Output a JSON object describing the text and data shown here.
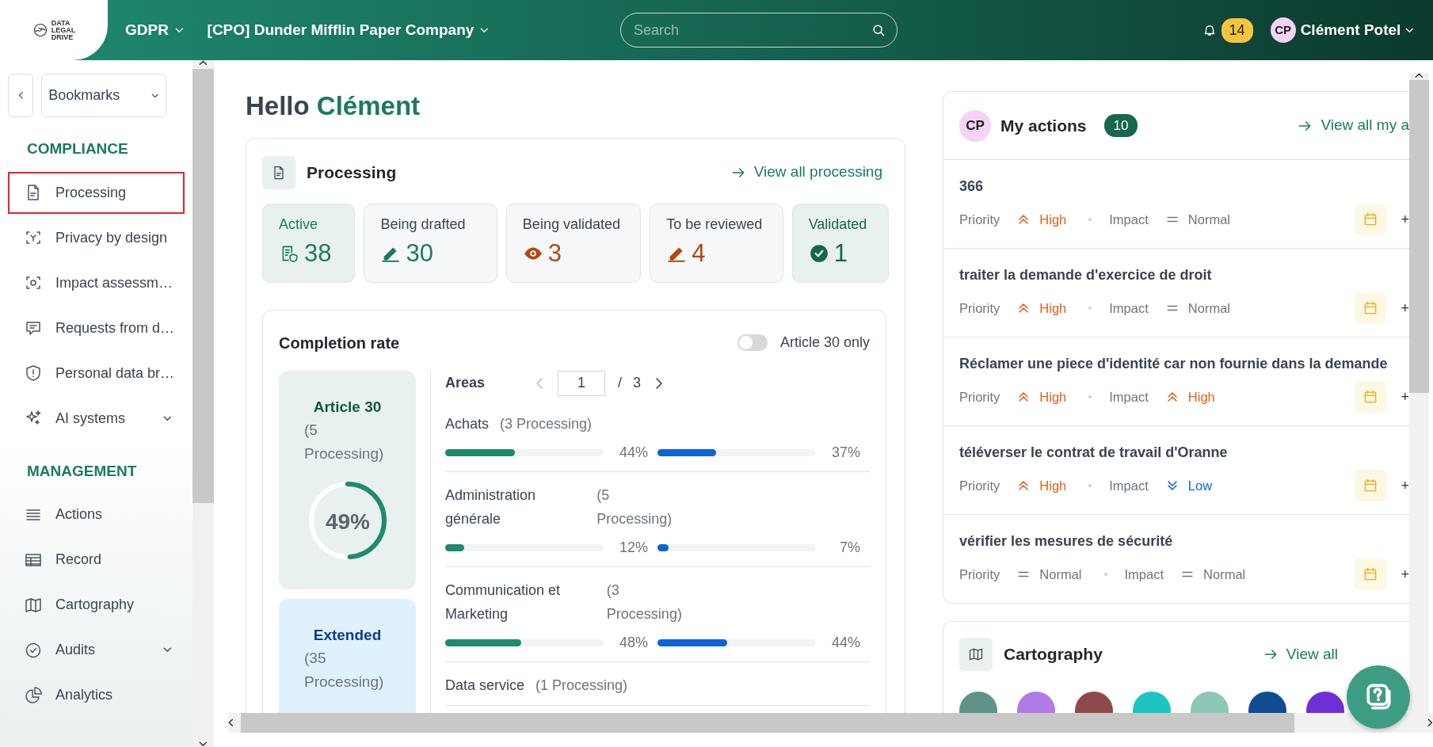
{
  "header": {
    "logo_lines": [
      "DATA",
      "LEGAL",
      "DRIVE"
    ],
    "app_menu": "GDPR",
    "org_menu": "[CPO] Dunder Mifflin Paper Company",
    "search": {
      "placeholder": "Search"
    },
    "notifications": "14",
    "user": {
      "initials": "CP",
      "name": "Clément Potel"
    }
  },
  "sidebar": {
    "bookmarks": "Bookmarks",
    "sections": [
      {
        "title": "COMPLIANCE",
        "items": [
          {
            "label": "Processing",
            "kind": "document",
            "selected": true,
            "expandable": false
          },
          {
            "label": "Privacy by design",
            "kind": "privacy",
            "selected": false,
            "expandable": false
          },
          {
            "label": "Impact assessm…",
            "kind": "impact",
            "selected": false,
            "expandable": false
          },
          {
            "label": "Requests from d…",
            "kind": "request",
            "selected": false,
            "expandable": false
          },
          {
            "label": "Personal data br…",
            "kind": "shield",
            "selected": false,
            "expandable": false
          },
          {
            "label": "AI systems",
            "kind": "sparkles",
            "selected": false,
            "expandable": true
          }
        ]
      },
      {
        "title": "MANAGEMENT",
        "items": [
          {
            "label": "Actions",
            "kind": "list",
            "selected": false,
            "expandable": false
          },
          {
            "label": "Record",
            "kind": "table",
            "selected": false,
            "expandable": false
          },
          {
            "label": "Cartography",
            "kind": "map",
            "selected": false,
            "expandable": false
          },
          {
            "label": "Audits",
            "kind": "badge",
            "selected": false,
            "expandable": true
          },
          {
            "label": "Analytics",
            "kind": "pie",
            "selected": false,
            "expandable": false
          }
        ]
      }
    ]
  },
  "greeting": {
    "hello": "Hello",
    "name": "Clément"
  },
  "processing": {
    "title": "Processing",
    "link": "View all processing",
    "stats": [
      {
        "label": "Active",
        "value": "38",
        "kind": "active"
      },
      {
        "label": "Being drafted",
        "value": "30",
        "kind": "drafted"
      },
      {
        "label": "Being validated",
        "value": "3",
        "kind": "validating"
      },
      {
        "label": "To be reviewed",
        "value": "4",
        "kind": "review"
      },
      {
        "label": "Validated",
        "value": "1",
        "kind": "validated"
      }
    ]
  },
  "completion": {
    "title": "Completion rate",
    "toggle": {
      "label": "Article 30 only",
      "on": false
    },
    "summaries": [
      {
        "kind": "article30",
        "title": "Article 30",
        "count": "(5 Processing)",
        "percent": "49%",
        "level": 0.49
      },
      {
        "kind": "extended",
        "title": "Extended",
        "count": "(35 Processing)"
      }
    ],
    "pager": {
      "label": "Areas",
      "page": "1",
      "separator": "/",
      "total": "3"
    },
    "areas": [
      {
        "name": "Achats",
        "count": "(3 Processing)",
        "article30": {
          "level": 0.44,
          "reading": "44%"
        },
        "extended": {
          "level": 0.37,
          "reading": "37%"
        }
      },
      {
        "name": "Administration générale",
        "count": "(5 Processing)",
        "article30": {
          "level": 0.12,
          "reading": "12%"
        },
        "extended": {
          "level": 0.07,
          "reading": "7%"
        }
      },
      {
        "name": "Communication et Marketing",
        "count": "(3 Processing)",
        "article30": {
          "level": 0.48,
          "reading": "48%"
        },
        "extended": {
          "level": 0.44,
          "reading": "44%"
        }
      },
      {
        "name": "Data service",
        "count": "(1 Processing)"
      }
    ]
  },
  "my_actions": {
    "initials": "CP",
    "title": "My actions",
    "count": "10",
    "link": "View all my a",
    "items": [
      {
        "title": "366",
        "priority_label": "Priority",
        "priority": {
          "label": "High",
          "kind": "high"
        },
        "impact_label": "Impact",
        "impact": {
          "label": "Normal",
          "kind": "normal"
        },
        "add": "+"
      },
      {
        "title": "traiter la demande d'exercice de droit",
        "priority_label": "Priority",
        "priority": {
          "label": "High",
          "kind": "high"
        },
        "impact_label": "Impact",
        "impact": {
          "label": "Normal",
          "kind": "normal"
        },
        "add": "+"
      },
      {
        "title": "Réclamer une piece d'identité car non fournie dans la demande",
        "priority_label": "Priority",
        "priority": {
          "label": "High",
          "kind": "high"
        },
        "impact_label": "Impact",
        "impact": {
          "label": "High",
          "kind": "high"
        },
        "add": "+"
      },
      {
        "title": "téléverser le contrat de travail d'Oranne",
        "priority_label": "Priority",
        "priority": {
          "label": "High",
          "kind": "high"
        },
        "impact_label": "Impact",
        "impact": {
          "label": "Low",
          "kind": "low"
        },
        "add": "+"
      },
      {
        "title": "vérifier les mesures de sécurité",
        "priority_label": "Priority",
        "priority": {
          "label": "Normal",
          "kind": "normal"
        },
        "impact_label": "Impact",
        "impact": {
          "label": "Normal",
          "kind": "normal"
        },
        "add": "+"
      }
    ]
  },
  "cartography": {
    "title": "Cartography",
    "link": "View all",
    "items": [
      {
        "color": "#5e9488"
      },
      {
        "color": "#b07be6"
      },
      {
        "color": "#8e4a4a"
      },
      {
        "color": "#1cc4c4"
      },
      {
        "color": "#8cc7b8"
      },
      {
        "color": "#0f4c92"
      },
      {
        "color": "#6f2fd6"
      }
    ]
  }
}
